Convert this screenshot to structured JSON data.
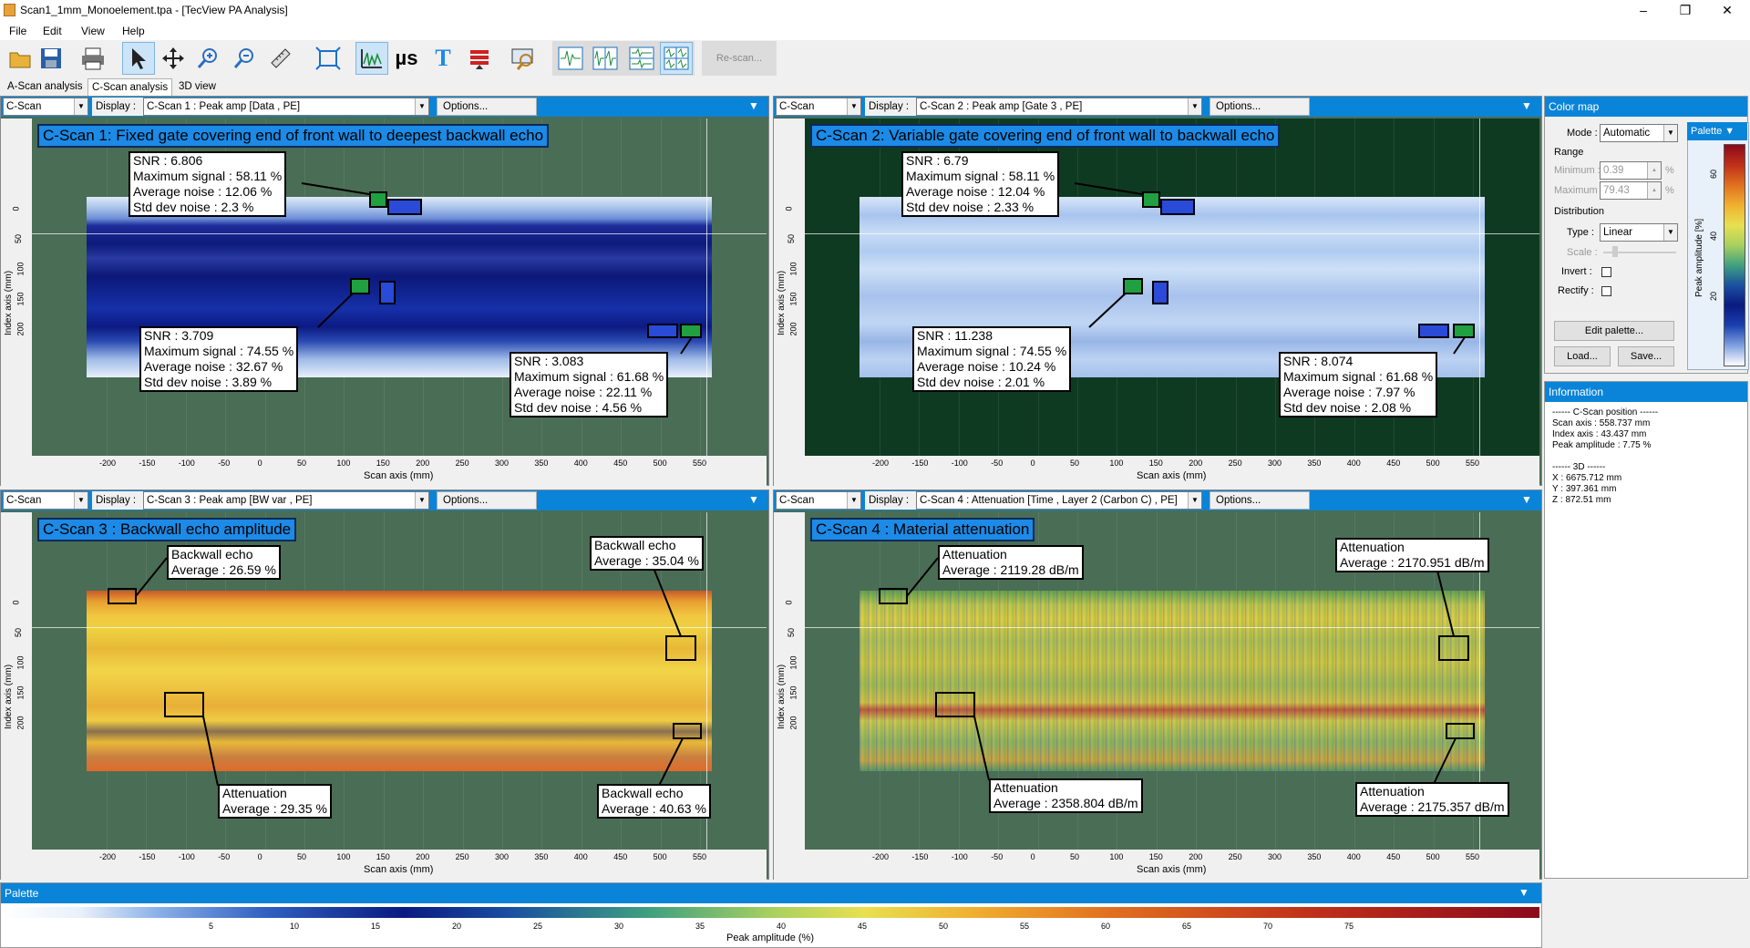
{
  "window": {
    "title": "Scan1_1mm_Monoelement.tpa - [TecView PA Analysis]"
  },
  "menu": [
    "File",
    "Edit",
    "View",
    "Help"
  ],
  "toolbar": {
    "rescan_label": "Re-scan...",
    "us_label": "µs",
    "t_label": "T"
  },
  "tabs": [
    "A-Scan analysis",
    "C-Scan analysis",
    "3D view"
  ],
  "panels": [
    {
      "view": "C-Scan",
      "display_label": "Display :",
      "display_value": "C-Scan 1 : Peak amp [Data , PE]",
      "options": "Options...",
      "title": "C-Scan 1: Fixed gate covering end of front wall to deepest backwall echo",
      "annotations": [
        [
          "SNR : 6.806",
          "Maximum signal : 58.11 %",
          "Average noise : 12.06 %",
          "Std dev noise : 2.3 %"
        ],
        [
          "SNR : 3.709",
          "Maximum signal : 74.55 %",
          "Average noise : 32.67 %",
          "Std dev noise : 3.89 %"
        ],
        [
          "SNR : 3.083",
          "Maximum signal : 61.68 %",
          "Average noise : 22.11 %",
          "Std dev noise : 4.56 %"
        ]
      ]
    },
    {
      "view": "C-Scan",
      "display_label": "Display :",
      "display_value": "C-Scan 2 : Peak amp [Gate 3 , PE]",
      "options": "Options...",
      "title": "C-Scan 2: Variable gate covering end of front wall to backwall echo",
      "annotations": [
        [
          "SNR : 6.79",
          "Maximum signal : 58.11 %",
          "Average noise : 12.04 %",
          "Std dev noise : 2.33 %"
        ],
        [
          "SNR : 11.238",
          "Maximum signal : 74.55 %",
          "Average noise : 10.24 %",
          "Std dev noise : 2.01 %"
        ],
        [
          "SNR : 8.074",
          "Maximum signal : 61.68 %",
          "Average noise : 7.97 %",
          "Std dev noise : 2.08 %"
        ]
      ]
    },
    {
      "view": "C-Scan",
      "display_label": "Display :",
      "display_value": "C-Scan 3 : Peak amp [BW var , PE]",
      "options": "Options...",
      "title": "C-Scan 3 : Backwall echo amplitude",
      "annotations": [
        [
          "Backwall echo",
          "Average : 26.59 %"
        ],
        [
          "Backwall echo",
          "Average : 35.04 %"
        ],
        [
          "Attenuation",
          "Average : 29.35 %"
        ],
        [
          "Backwall echo",
          "Average : 40.63 %"
        ]
      ]
    },
    {
      "view": "C-Scan",
      "display_label": "Display :",
      "display_value": "C-Scan 4 : Attenuation [Time , Layer 2 (Carbon C) , PE]",
      "options": "Options...",
      "title": "C-Scan 4 : Material attenuation",
      "annotations": [
        [
          "Attenuation",
          "Average : 2119.28 dB/m"
        ],
        [
          "Attenuation",
          "Average : 2170.951 dB/m"
        ],
        [
          "Attenuation",
          "Average : 2358.804 dB/m"
        ],
        [
          "Attenuation",
          "Average : 2175.357 dB/m"
        ]
      ]
    }
  ],
  "axes": {
    "x_label": "Scan axis (mm)",
    "y_label": "Index axis (mm)",
    "x_ticks": [
      "-200",
      "-150",
      "-100",
      "-50",
      "0",
      "50",
      "100",
      "150",
      "200",
      "250",
      "300",
      "350",
      "400",
      "450",
      "500",
      "550"
    ],
    "y_ticks": [
      "0",
      "50",
      "100",
      "150",
      "200"
    ]
  },
  "colormap": {
    "header": "Color map",
    "mode_label": "Mode :",
    "mode_value": "Automatic",
    "range_label": "Range",
    "min_label": "Minimum :",
    "min_value": "0.39",
    "max_label": "Maximum :",
    "max_value": "79.43",
    "unit": "%",
    "distribution_label": "Distribution",
    "type_label": "Type :",
    "type_value": "Linear",
    "scale_label": "Scale :",
    "invert_label": "Invert :",
    "rectify_label": "Rectify :",
    "edit_palette": "Edit palette...",
    "load": "Load...",
    "save": "Save...",
    "palette_tab": "Palette",
    "palette_axis_label": "Peak amplitude [%]",
    "palette_ticks": [
      "60",
      "40",
      "20"
    ]
  },
  "information": {
    "header": "Information",
    "lines": [
      "------ C-Scan position ------",
      "Scan axis : 558.737 mm",
      "Index axis : 43.437 mm",
      "Peak amplitude : 7.75 %",
      "",
      "------ 3D ------",
      "X : 6675.712 mm",
      "Y : 397.361 mm",
      "Z : 872.51 mm"
    ]
  },
  "palette": {
    "header": "Palette",
    "ticks": [
      "5",
      "10",
      "15",
      "20",
      "25",
      "30",
      "35",
      "40",
      "45",
      "50",
      "55",
      "60",
      "65",
      "70",
      "75"
    ],
    "label": "Peak amplitude (%)"
  },
  "colors": {
    "header_blue": "#0a84d8",
    "panel_bg": "#4a6d55",
    "title_blue": "#1c8ae6"
  }
}
